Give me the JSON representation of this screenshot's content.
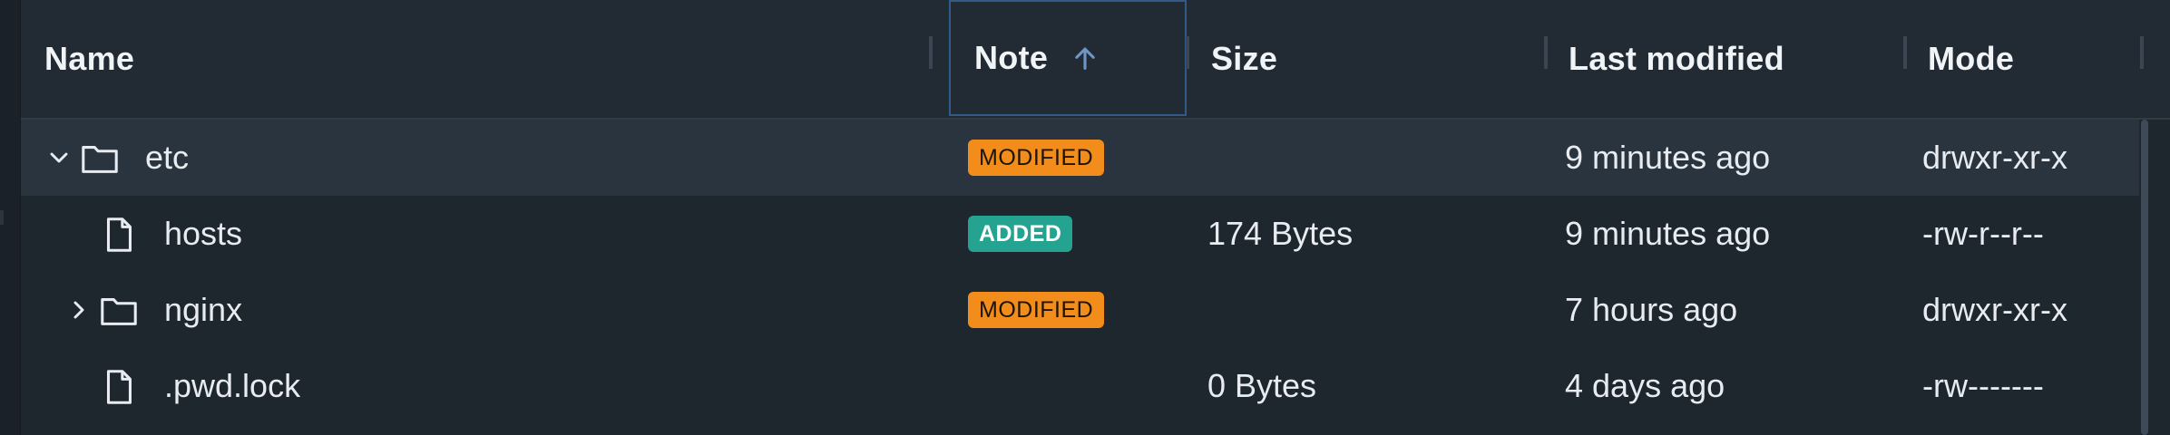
{
  "columns": {
    "name": "Name",
    "note": "Note",
    "size": "Size",
    "last_modified": "Last modified",
    "mode": "Mode"
  },
  "sort": {
    "column": "Note",
    "direction": "ascending",
    "icon": "arrow-up-icon"
  },
  "colors": {
    "badge_modified": "#f28c1b",
    "badge_added": "#25a391",
    "sort_arrow": "#6f95c6",
    "selected_row": "#2a343e"
  },
  "rows": [
    {
      "name": "etc",
      "type": "folder",
      "expanded": true,
      "note": "MODIFIED",
      "size": "",
      "last_modified": "9 minutes ago",
      "mode": "drwxr-xr-x"
    },
    {
      "name": "hosts",
      "type": "file",
      "note": "ADDED",
      "size": "174 Bytes",
      "last_modified": "9 minutes ago",
      "mode": "-rw-r--r--"
    },
    {
      "name": "nginx",
      "type": "folder",
      "expanded": false,
      "note": "MODIFIED",
      "size": "",
      "last_modified": "7 hours ago",
      "mode": "drwxr-xr-x"
    },
    {
      "name": ".pwd.lock",
      "type": "file",
      "note": "",
      "size": "0 Bytes",
      "last_modified": "4 days ago",
      "mode": "-rw-------"
    }
  ]
}
